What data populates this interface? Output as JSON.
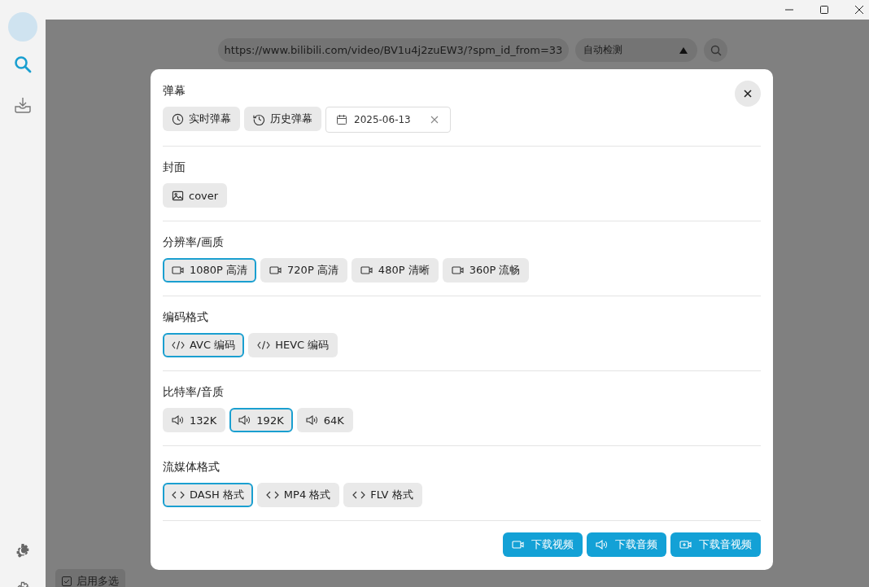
{
  "sidebar": {
    "items": [
      {
        "kind": "search",
        "selected": true
      },
      {
        "kind": "download",
        "selected": false
      }
    ],
    "bottom_items": [
      {
        "kind": "theme"
      },
      {
        "kind": "settings"
      }
    ]
  },
  "search_bar": {
    "url": "https://www.bilibili.com/video/BV1u4j2zuEW3/?spm_id_from=33",
    "mode": "自动检测"
  },
  "multi_select": {
    "label": "启用多选",
    "checked": true
  },
  "dialog": {
    "sections": [
      {
        "title": "弹幕",
        "options": [
          {
            "kind": "clock",
            "label": "实时弹幕",
            "selected": false
          },
          {
            "kind": "history",
            "label": "历史弹幕",
            "selected": false
          }
        ],
        "date": {
          "value": "2025-06-13"
        }
      },
      {
        "title": "封面",
        "options": [
          {
            "kind": "image",
            "label": "cover",
            "selected": false
          }
        ]
      },
      {
        "title": "分辨率/画质",
        "options": [
          {
            "kind": "video",
            "label": "1080P 高清",
            "selected": true
          },
          {
            "kind": "video",
            "label": "720P 高清",
            "selected": false
          },
          {
            "kind": "video",
            "label": "480P 清晰",
            "selected": false
          },
          {
            "kind": "video",
            "label": "360P 流畅",
            "selected": false
          }
        ]
      },
      {
        "title": "编码格式",
        "options": [
          {
            "kind": "code",
            "label": "AVC 编码",
            "selected": true
          },
          {
            "kind": "code",
            "label": "HEVC 编码",
            "selected": false
          }
        ]
      },
      {
        "title": "比特率/音质",
        "options": [
          {
            "kind": "audio",
            "label": "132K",
            "selected": false
          },
          {
            "kind": "audio",
            "label": "192K",
            "selected": true
          },
          {
            "kind": "audio",
            "label": "64K",
            "selected": false
          }
        ]
      },
      {
        "title": "流媒体格式",
        "options": [
          {
            "kind": "brackets",
            "label": "DASH 格式",
            "selected": true
          },
          {
            "kind": "brackets",
            "label": "MP4 格式",
            "selected": false
          },
          {
            "kind": "brackets",
            "label": "FLV 格式",
            "selected": false
          }
        ]
      }
    ],
    "actions": [
      {
        "kind": "video",
        "label": "下载视频"
      },
      {
        "kind": "audio",
        "label": "下载音频"
      },
      {
        "kind": "video-plus",
        "label": "下载音视频"
      }
    ]
  }
}
